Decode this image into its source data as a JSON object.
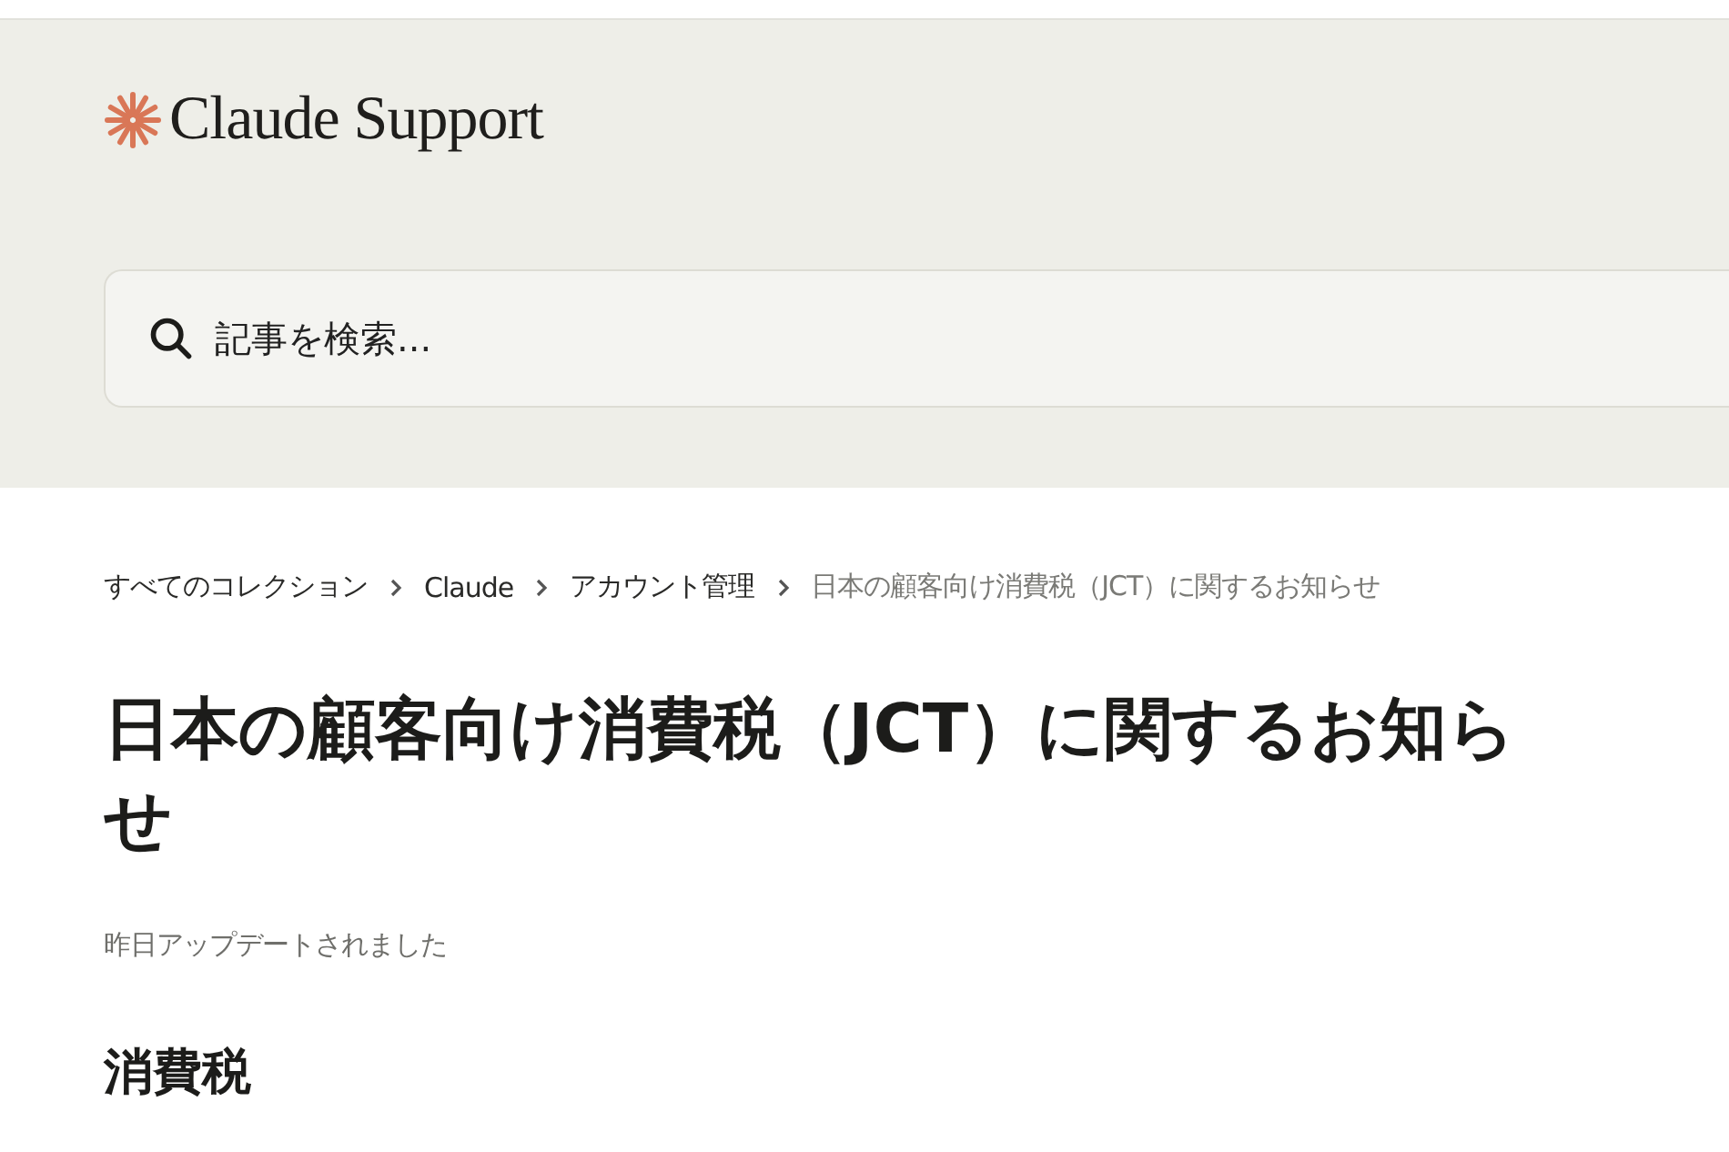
{
  "header": {
    "logo_text": "Claude Support",
    "search": {
      "placeholder": "記事を検索..."
    }
  },
  "breadcrumb": [
    {
      "label": "すべてのコレクション",
      "current": false
    },
    {
      "label": "Claude",
      "current": false
    },
    {
      "label": "アカウント管理",
      "current": false
    },
    {
      "label": "日本の顧客向け消費税（JCT）に関するお知らせ",
      "current": true
    }
  ],
  "article": {
    "title": "日本の顧客向け消費税（JCT）に関するお知らせ",
    "updated": "昨日アップデートされました",
    "section_heading": "消費税"
  }
}
